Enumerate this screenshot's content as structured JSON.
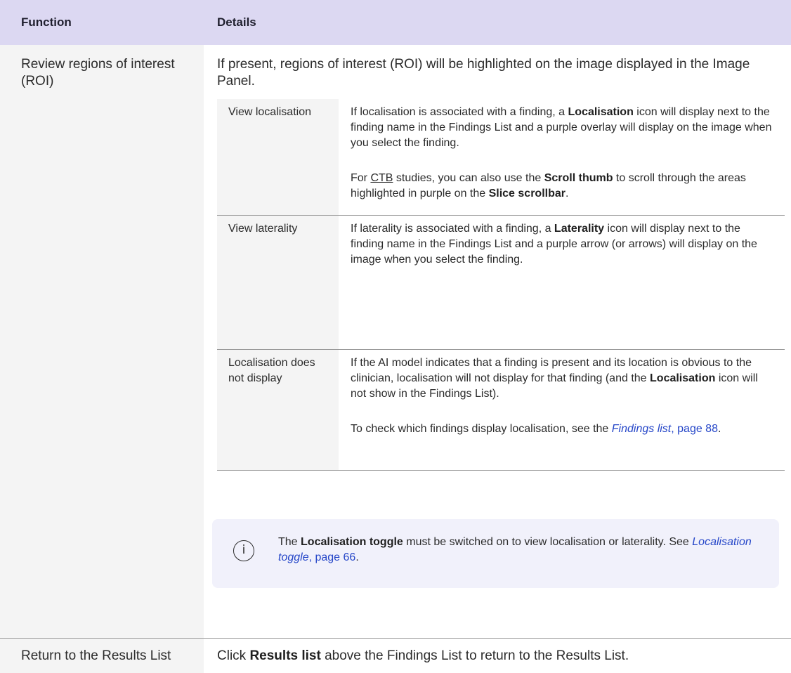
{
  "header": {
    "function": "Function",
    "details": "Details"
  },
  "rows": [
    {
      "function": "Review regions of interest (ROI)",
      "details": "If present, regions of interest (ROI) will be highlighted on the image displayed in the Image Panel.",
      "subrows": [
        {
          "label": "View localisation",
          "p1": {
            "t1": "If localisation is associated with a finding, a ",
            "b1": "Localisation",
            "t2": " icon will display next to the finding name in the Findings List and a purple overlay will display on the image when you select the finding."
          },
          "p2": {
            "t1": "For ",
            "u1": "CTB",
            "t2": " studies, you can also use the ",
            "b1": "Scroll thumb",
            "t3": " to scroll through the areas highlighted in purple on the ",
            "b2": "Slice scrollbar",
            "t4": "."
          }
        },
        {
          "label": "View laterality",
          "p1": {
            "t1": "If laterality is associated with a finding, a ",
            "b1": "Laterality",
            "t2": " icon will display next to the finding name in the Findings List and a purple arrow (or arrows) will display on the image when you select the finding."
          }
        },
        {
          "label": "Localisation does not display",
          "p1": {
            "t1": "If the AI model indicates that a finding is present and its location is obvious to the clinician, localisation will not display for that finding (and the ",
            "b1": "Localisation",
            "t2": " icon will not show in the Findings List)."
          },
          "p2": {
            "t1": "To check which findings display localisation, see the ",
            "link_italic": "Findings list",
            "link_rest": ", page 88",
            "t2": "."
          }
        }
      ],
      "note": {
        "icon": "info-icon",
        "icon_glyph": "i",
        "t1": "The ",
        "b1": "Localisation toggle",
        "t2": " must be switched on to view localisation or laterality. See ",
        "link_italic": "Localisation toggle",
        "link_rest": ", page 66",
        "t3": "."
      }
    },
    {
      "function": "Return to the Results List",
      "details": {
        "t1": "Click ",
        "b1": "Results list",
        "t2": " above the Findings List to return to the Results List."
      }
    }
  ],
  "colors": {
    "header_bg": "#dcd8f2",
    "left_col_bg": "#f4f4f4",
    "note_bg": "#f1f1fb",
    "link": "#2546c8"
  }
}
